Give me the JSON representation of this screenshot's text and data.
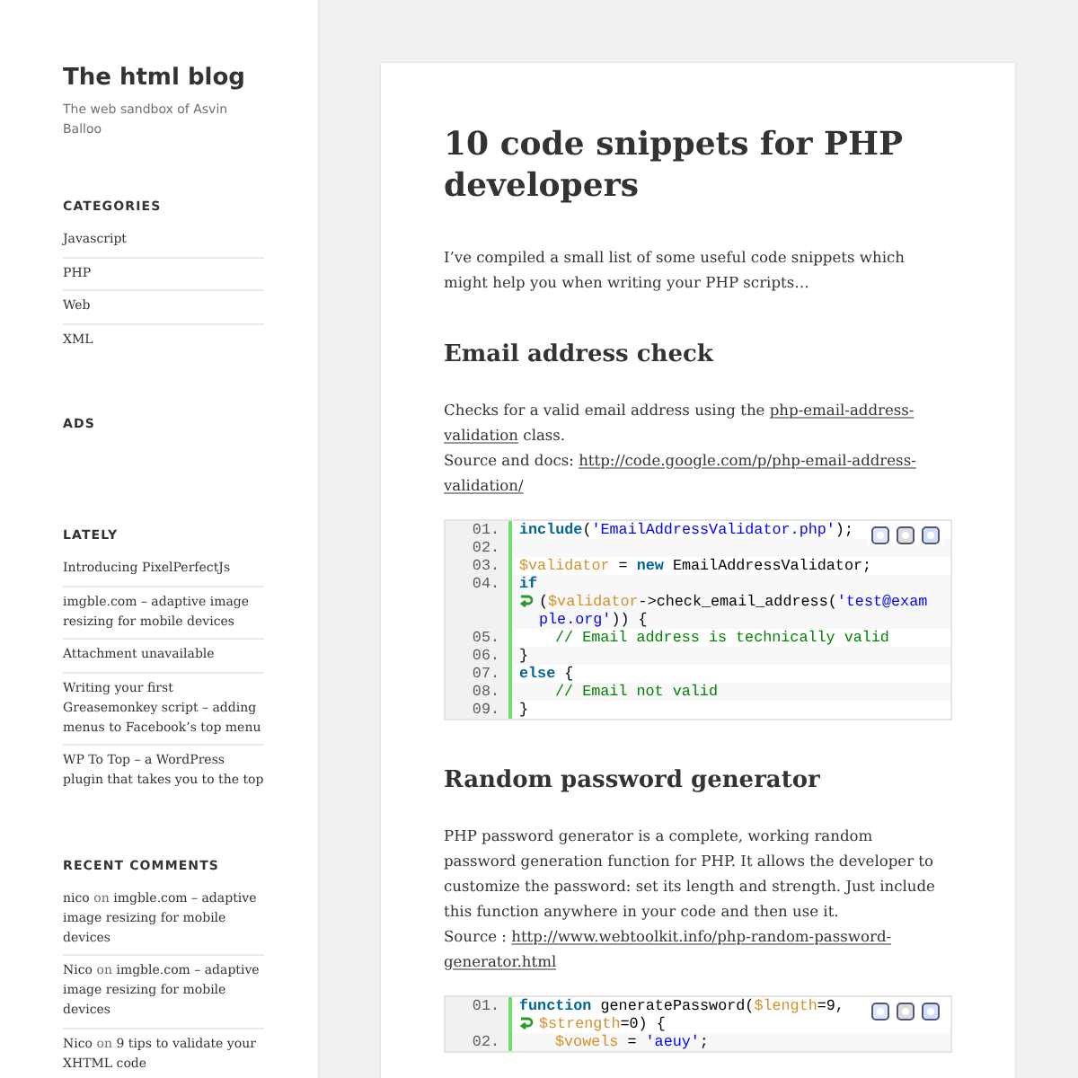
{
  "site": {
    "title": "The html blog",
    "tagline": "The web sandbox of Asvin Balloo"
  },
  "widgets": [
    {
      "kind": "links",
      "title": "CATEGORIES",
      "items": [
        "Javascript",
        "PHP",
        "Web",
        "XML"
      ]
    },
    {
      "kind": "empty",
      "title": "ADS"
    },
    {
      "kind": "links",
      "title": "LATELY",
      "items": [
        "Introducing PixelPerfectJs",
        "imgble.com – adaptive image resizing for mobile devices",
        "Attachment unavailable",
        "Writing your first Greasemonkey script – adding menus to Facebook’s top menu",
        "WP To Top – a WordPress plugin that takes you to the top"
      ]
    },
    {
      "kind": "comments",
      "title": "RECENT COMMENTS",
      "items": [
        {
          "author": "nico",
          "joiner": "on",
          "post": "imgble.com – adaptive image resizing for mobile devices"
        },
        {
          "author": "Nico",
          "joiner": "on",
          "post": "imgble.com – adaptive image resizing for mobile devices"
        },
        {
          "author": "Nico",
          "joiner": "on",
          "post": "9 tips to validate your XHTML code"
        }
      ]
    }
  ],
  "post": {
    "title": "10 code snippets for PHP developers",
    "blocks": [
      {
        "kind": "para",
        "lines": [
          [
            {
              "kind": "text",
              "t": "I’ve compiled a small list of some useful code snippets which might help you when writing your PHP scripts…"
            }
          ]
        ]
      },
      {
        "kind": "heading",
        "text": "Email address check"
      },
      {
        "kind": "para",
        "lines": [
          [
            {
              "kind": "text",
              "t": "Checks for a valid email address using the "
            },
            {
              "kind": "link",
              "t": "php-email-address-"
            }
          ],
          [
            {
              "kind": "link",
              "t": "validation"
            },
            {
              "kind": "text",
              "t": " class."
            }
          ],
          [
            {
              "kind": "text",
              "t": "Source and docs: "
            },
            {
              "kind": "link",
              "t": "http://code.google.com/p/php-email-address-"
            }
          ],
          [
            {
              "kind": "link",
              "t": "validation/"
            }
          ]
        ]
      },
      {
        "kind": "code",
        "lines": [
          {
            "kind": "numbered",
            "number": "01.",
            "tokens": [
              {
                "kind": "kw",
                "t": "include"
              },
              {
                "kind": "pl",
                "t": "("
              },
              {
                "kind": "str",
                "t": "'EmailAddressValidator.php'"
              },
              {
                "kind": "pl",
                "t": ");"
              }
            ]
          },
          {
            "kind": "numbered",
            "number": "02."
          },
          {
            "kind": "numbered",
            "number": "03.",
            "tokens": [
              {
                "kind": "var",
                "t": "$validator"
              },
              {
                "kind": "pl",
                "t": " = "
              },
              {
                "kind": "kw",
                "t": "new"
              },
              {
                "kind": "pl",
                "t": " EmailAddressValidator;"
              }
            ]
          },
          {
            "kind": "numbered",
            "number": "04.",
            "tokens": [
              {
                "kind": "kw",
                "t": "if"
              }
            ]
          },
          {
            "kind": "wrapped",
            "tokens": [
              {
                "kind": "pl",
                "t": "("
              },
              {
                "kind": "var",
                "t": "$validator"
              },
              {
                "kind": "pl",
                "t": "->check_email_address("
              },
              {
                "kind": "str",
                "t": "'test@exam"
              }
            ]
          },
          {
            "kind": "continued",
            "tokens": [
              {
                "kind": "str",
                "t": "ple.org'"
              },
              {
                "kind": "pl",
                "t": ")) {"
              }
            ]
          },
          {
            "kind": "numbered",
            "number": "05.",
            "indented": true,
            "tokens": [
              {
                "kind": "cm",
                "t": "// Email address is technically valid"
              }
            ]
          },
          {
            "kind": "numbered",
            "number": "06.",
            "tokens": [
              {
                "kind": "pl",
                "t": "}"
              }
            ]
          },
          {
            "kind": "numbered",
            "number": "07.",
            "tokens": [
              {
                "kind": "kw",
                "t": "else"
              },
              {
                "kind": "pl",
                "t": " {"
              }
            ]
          },
          {
            "kind": "numbered",
            "number": "08.",
            "indented": true,
            "tokens": [
              {
                "kind": "cm",
                "t": "// Email not valid"
              }
            ]
          },
          {
            "kind": "numbered",
            "number": "09.",
            "tokens": [
              {
                "kind": "pl",
                "t": "}"
              }
            ]
          }
        ]
      },
      {
        "kind": "heading",
        "text": "Random password generator"
      },
      {
        "kind": "para",
        "lines": [
          [
            {
              "kind": "text",
              "t": "PHP password generator is a complete, working random"
            }
          ],
          [
            {
              "kind": "text",
              "t": "password generation function for PHP. It allows the developer to"
            }
          ],
          [
            {
              "kind": "text",
              "t": "customize the password: set its length and strength. Just include"
            }
          ],
          [
            {
              "kind": "text",
              "t": "this function anywhere in your code and then use it."
            }
          ],
          [
            {
              "kind": "text",
              "t": "Source : "
            },
            {
              "kind": "link",
              "t": "http://www.webtoolkit.info/php-random-password-"
            }
          ],
          [
            {
              "kind": "link",
              "t": "generator.html"
            }
          ]
        ]
      },
      {
        "kind": "code",
        "lines": [
          {
            "kind": "numbered",
            "number": "01.",
            "tokens": [
              {
                "kind": "kw",
                "t": "function"
              },
              {
                "kind": "pl",
                "t": " generatePassword("
              },
              {
                "kind": "var",
                "t": "$length"
              },
              {
                "kind": "pl",
                "t": "=9,"
              }
            ]
          },
          {
            "kind": "wrapped",
            "tokens": [
              {
                "kind": "var",
                "t": "$strength"
              },
              {
                "kind": "pl",
                "t": "=0) {"
              }
            ]
          },
          {
            "kind": "numbered",
            "number": "02.",
            "indented": true,
            "tokens": [
              {
                "kind": "var",
                "t": "$vowels"
              },
              {
                "kind": "pl",
                "t": " = "
              },
              {
                "kind": "str",
                "t": "'aeuy'"
              },
              {
                "kind": "pl",
                "t": ";"
              }
            ]
          }
        ]
      }
    ]
  }
}
